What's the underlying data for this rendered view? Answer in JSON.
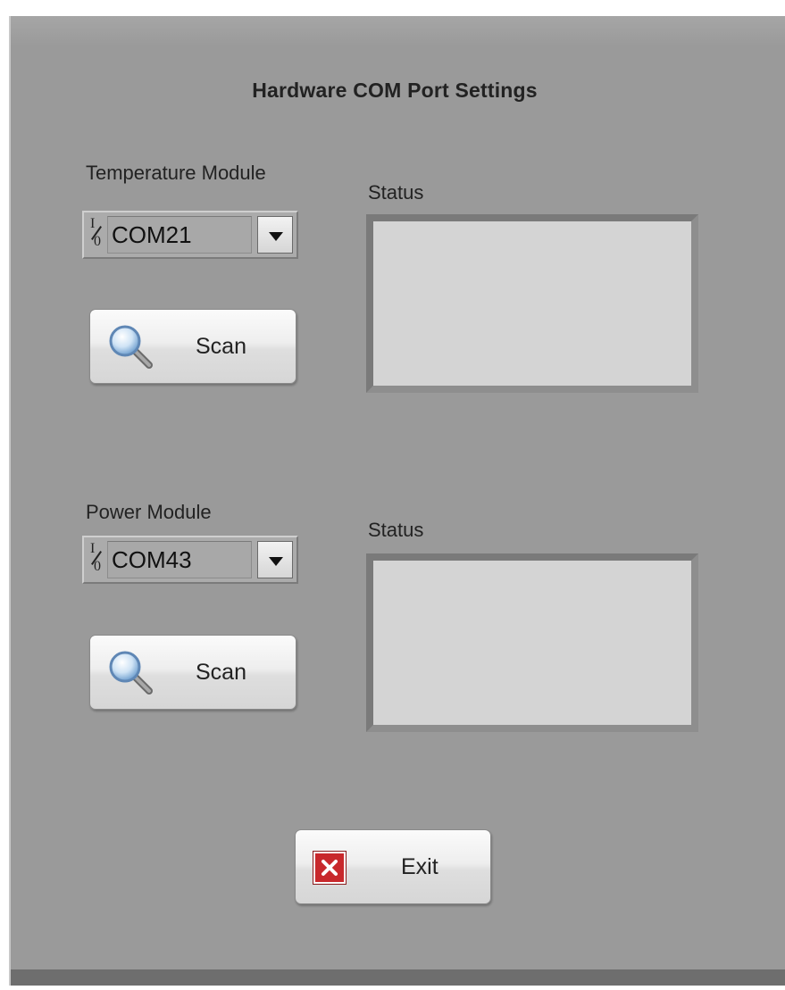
{
  "title": "Hardware COM Port  Settings",
  "temperature": {
    "label": "Temperature  Module",
    "port_value": "COM21",
    "scan_label": "Scan",
    "status_label": "Status",
    "status_text": ""
  },
  "power": {
    "label": "Power  Module",
    "port_value": "COM43",
    "scan_label": "Scan",
    "status_label": "Status",
    "status_text": ""
  },
  "exit_label": "Exit",
  "icons": {
    "io": "io-indicator-icon",
    "dropdown": "dropdown-arrow-icon",
    "scan": "magnifier-icon",
    "exit": "red-x-icon"
  },
  "colors": {
    "panel": "#9a9a9a",
    "status_bg": "#d4d4d4",
    "exit_red": "#c8282c"
  }
}
